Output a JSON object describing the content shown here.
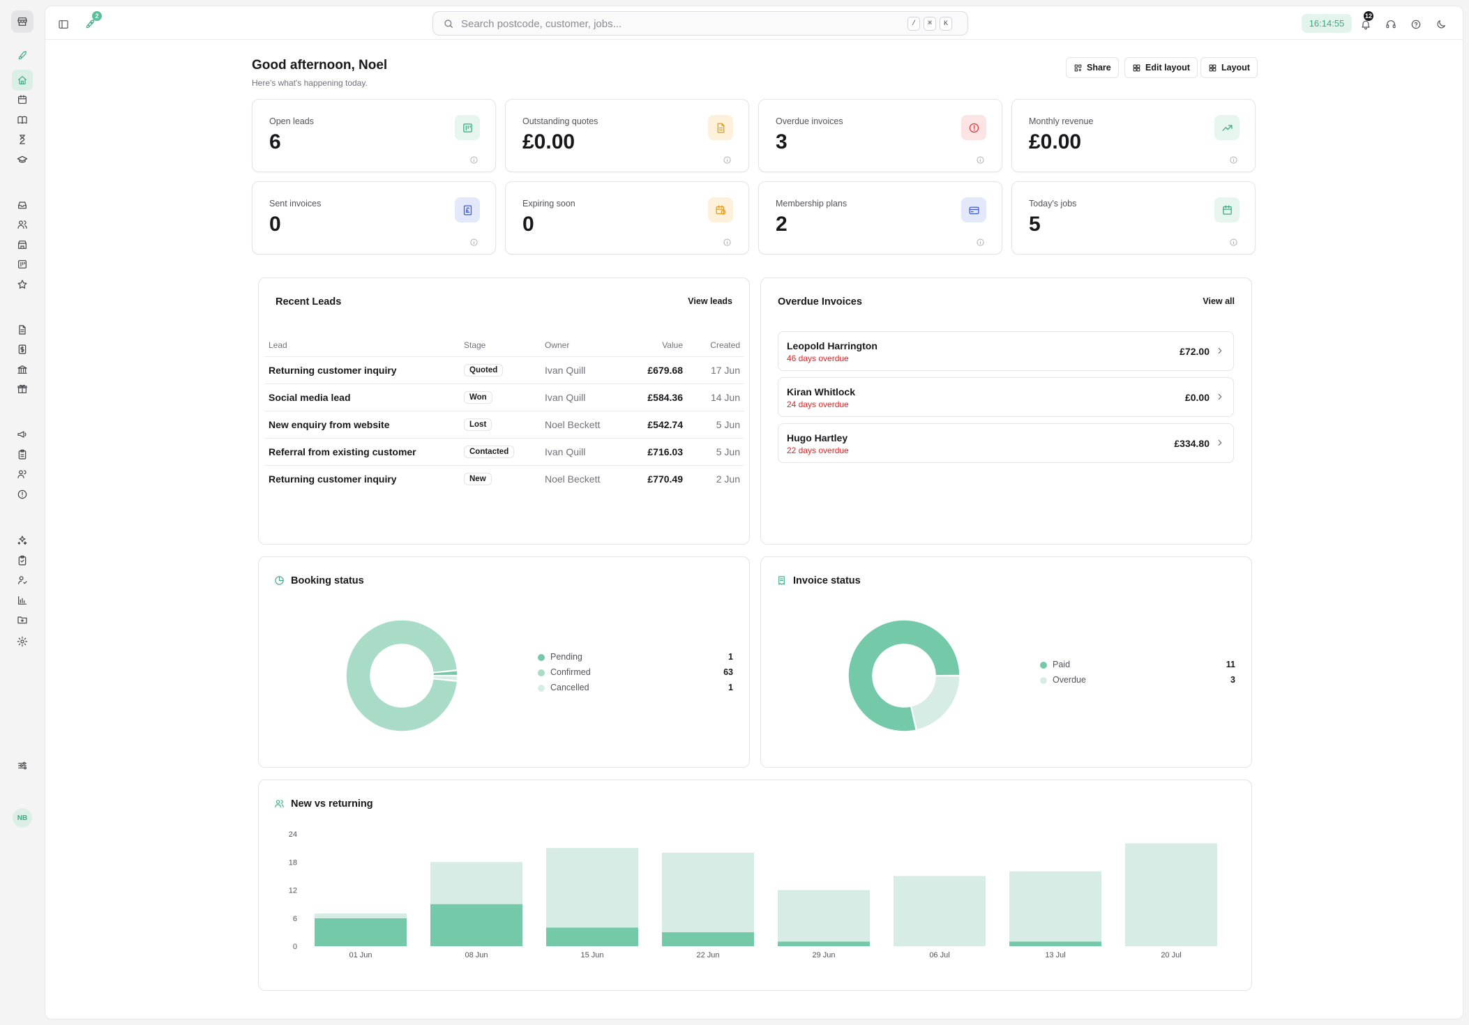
{
  "topbar": {
    "rocket_badge": "2",
    "search_placeholder": "Search postcode, customer, jobs...",
    "shortcut_keys": [
      "/",
      "⌘",
      "K"
    ],
    "clock": "16:14:55",
    "notification_count": "12"
  },
  "sidebar": {
    "avatar_initials": "NB",
    "items": [
      "rocket-icon",
      "home-icon",
      "calendar-icon",
      "book-icon",
      "hourglass-icon",
      "graduation-cap-icon",
      "inbox-icon",
      "users-icon",
      "building-icon",
      "board-icon",
      "star-icon",
      "file-icon",
      "invoice-icon",
      "bank-icon",
      "gift-icon",
      "megaphone-icon",
      "clipboard-icon",
      "team-icon",
      "alert-icon",
      "sparkles-icon",
      "clipboard-check-icon",
      "user-check-icon",
      "bar-chart-icon",
      "folder-icon",
      "settings-icon",
      "sliders-icon"
    ]
  },
  "header": {
    "greeting": "Good afternoon, Noel",
    "subtitle": "Here's what's happening today.",
    "share_label": "Share",
    "edit_layout_label": "Edit layout",
    "layout_label": "Layout"
  },
  "kpis": [
    {
      "label": "Open leads",
      "value": "6",
      "icon": "board-icon",
      "color": "#3aa982",
      "bg": "#e6f5ee"
    },
    {
      "label": "Outstanding quotes",
      "value": "£0.00",
      "icon": "file-text-icon",
      "color": "#e59b1c",
      "bg": "#fdf1dc"
    },
    {
      "label": "Overdue invoices",
      "value": "3",
      "icon": "alert-circle-icon",
      "color": "#dc3b3b",
      "bg": "#fde4e4"
    },
    {
      "label": "Monthly revenue",
      "value": "£0.00",
      "icon": "trending-up-icon",
      "color": "#3aa982",
      "bg": "#e6f5ee"
    },
    {
      "label": "Sent invoices",
      "value": "0",
      "icon": "pound-receipt-icon",
      "color": "#3b5bdb",
      "bg": "#e3e9fb"
    },
    {
      "label": "Expiring soon",
      "value": "0",
      "icon": "calendar-clock-icon",
      "color": "#e59b1c",
      "bg": "#fdf1dc"
    },
    {
      "label": "Membership plans",
      "value": "2",
      "icon": "credit-card-icon",
      "color": "#3b5bdb",
      "bg": "#e3e9fb"
    },
    {
      "label": "Today's jobs",
      "value": "5",
      "icon": "calendar-icon",
      "color": "#3aa982",
      "bg": "#e6f5ee"
    }
  ],
  "recent_leads": {
    "title": "Recent Leads",
    "link": "View leads",
    "columns": [
      "Lead",
      "Stage",
      "Owner",
      "Value",
      "Created"
    ],
    "rows": [
      {
        "lead": "Returning customer inquiry",
        "stage": "Quoted",
        "owner": "Ivan Quill",
        "value": "£679.68",
        "created": "17 Jun"
      },
      {
        "lead": "Social media lead",
        "stage": "Won",
        "owner": "Ivan Quill",
        "value": "£584.36",
        "created": "14 Jun"
      },
      {
        "lead": "New enquiry from website",
        "stage": "Lost",
        "owner": "Noel Beckett",
        "value": "£542.74",
        "created": "5 Jun"
      },
      {
        "lead": "Referral from existing customer",
        "stage": "Contacted",
        "owner": "Ivan Quill",
        "value": "£716.03",
        "created": "5 Jun"
      },
      {
        "lead": "Returning customer inquiry",
        "stage": "New",
        "owner": "Noel Beckett",
        "value": "£770.49",
        "created": "2 Jun"
      }
    ]
  },
  "overdue_invoices": {
    "title": "Overdue Invoices",
    "link": "View all",
    "items": [
      {
        "name": "Leopold Harrington",
        "overdue": "46 days overdue",
        "amount": "£72.00"
      },
      {
        "name": "Kiran Whitlock",
        "overdue": "24 days overdue",
        "amount": "£0.00"
      },
      {
        "name": "Hugo Hartley",
        "overdue": "22 days overdue",
        "amount": "£334.80"
      }
    ]
  },
  "colors": {
    "accent": "#3aa982",
    "series_dark": "#74c9a8",
    "series_mid": "#a9dcc7",
    "series_light": "#d7ece4",
    "danger": "#dc2626"
  },
  "chart_data": [
    {
      "type": "pie",
      "title": "Booking status",
      "donut": true,
      "labels": [
        "Pending",
        "Confirmed",
        "Cancelled"
      ],
      "values": [
        1,
        63,
        1
      ],
      "colors": [
        "#74c9a8",
        "#a9dcc7",
        "#d7ece4"
      ],
      "legend": "right"
    },
    {
      "type": "pie",
      "title": "Invoice status",
      "donut": true,
      "labels": [
        "Paid",
        "Overdue"
      ],
      "values": [
        11,
        3
      ],
      "colors": [
        "#74c9a8",
        "#d7ece4"
      ],
      "legend": "right"
    },
    {
      "type": "bar",
      "stacked": true,
      "title": "New vs returning",
      "categories": [
        "01 Jun",
        "08 Jun",
        "15 Jun",
        "22 Jun",
        "29 Jun",
        "06 Jul",
        "13 Jul",
        "20 Jul"
      ],
      "series": [
        {
          "values": [
            6,
            9,
            4,
            3,
            1,
            0,
            1,
            0
          ],
          "color": "#74c9a8"
        },
        {
          "values": [
            1,
            9,
            17,
            17,
            11,
            15,
            15,
            22
          ],
          "color": "#d7ece4"
        }
      ],
      "yticks": [
        0,
        6,
        12,
        18,
        24
      ],
      "ylim": [
        0,
        24
      ],
      "grid": false
    }
  ]
}
